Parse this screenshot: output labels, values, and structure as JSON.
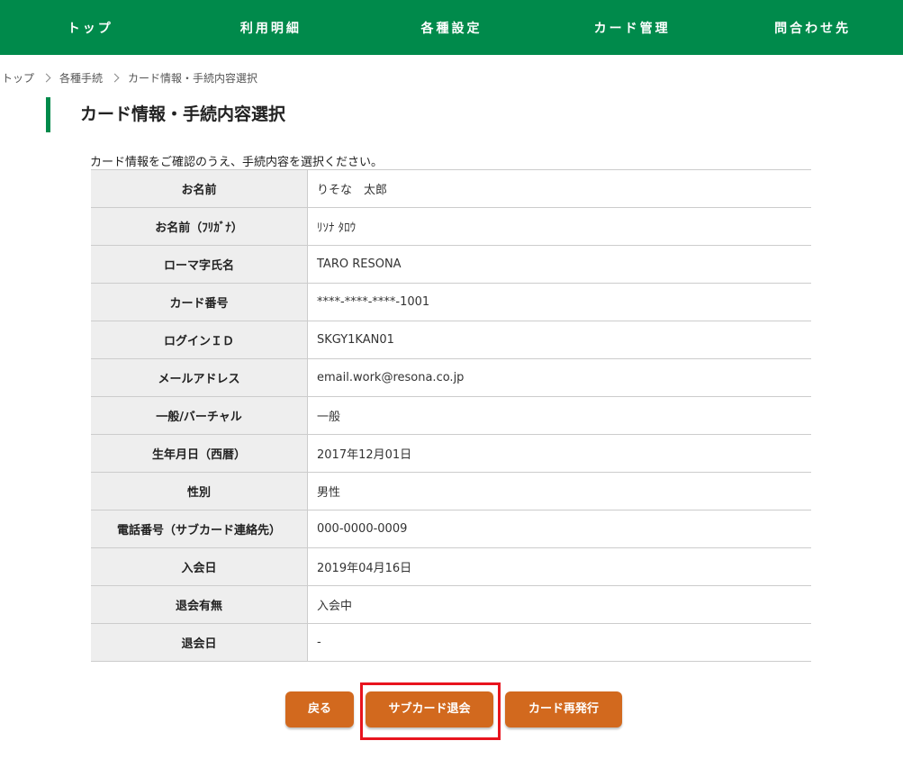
{
  "theme": {
    "nav_bg": "#008a4b",
    "accent_green": "#008a4b",
    "button_bg": "#d2691e",
    "highlight": "#e8141e"
  },
  "nav": {
    "items": [
      {
        "label": "トップ"
      },
      {
        "label": "利用明細"
      },
      {
        "label": "各種設定"
      },
      {
        "label": "カード管理"
      },
      {
        "label": "問合わせ先"
      }
    ]
  },
  "breadcrumb": {
    "items": [
      "トップ",
      "各種手続",
      "カード情報・手続内容選択"
    ]
  },
  "page": {
    "title": "カード情報・手続内容選択",
    "intro": "カード情報をご確認のうえ、手続内容を選択ください。"
  },
  "table": {
    "rows": [
      {
        "label": "お名前",
        "value": "りそな　太郎"
      },
      {
        "label": "お名前（ﾌﾘｶﾞﾅ）",
        "value": "ﾘｿﾅ ﾀﾛｳ"
      },
      {
        "label": "ローマ字氏名",
        "value": "TARO RESONA"
      },
      {
        "label": "カード番号",
        "value": "****-****-****-1001"
      },
      {
        "label": "ログインＩＤ",
        "value": "SKGY1KAN01"
      },
      {
        "label": "メールアドレス",
        "value": "email.work@resona.co.jp"
      },
      {
        "label": "一般/バーチャル",
        "value": "一般"
      },
      {
        "label": "生年月日（西暦）",
        "value": "2017年12月01日"
      },
      {
        "label": "性別",
        "value": "男性"
      },
      {
        "label": "電話番号（サブカード連絡先）",
        "value": "000-0000-0009"
      },
      {
        "label": "入会日",
        "value": "2019年04月16日"
      },
      {
        "label": "退会有無",
        "value": "入会中"
      },
      {
        "label": "退会日",
        "value": "-"
      }
    ]
  },
  "buttons": {
    "back": "戻る",
    "sub_card_cancel": "サブカード退会",
    "reissue": "カード再発行"
  }
}
